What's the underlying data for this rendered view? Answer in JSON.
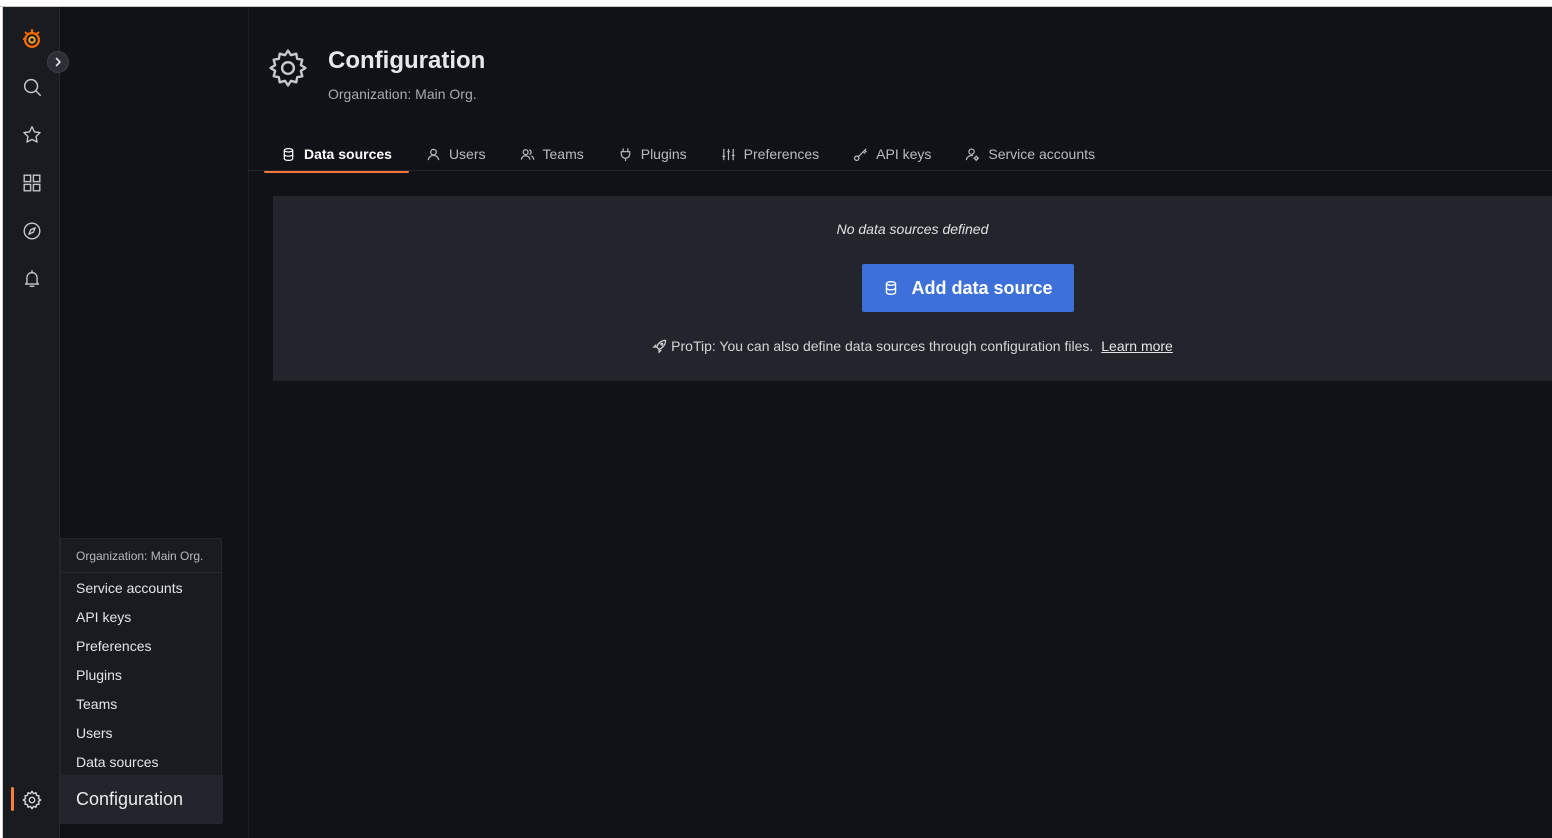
{
  "sidebar": {
    "icons": [
      "grafana-logo-icon",
      "search-icon",
      "star-icon",
      "dashboards-icon",
      "explore-compass-icon",
      "alerting-bell-icon",
      "configuration-gear-icon"
    ],
    "expand_icon": "chevron-right-icon",
    "accent_color": "#ff7d3a"
  },
  "flyout": {
    "header": "Organization: Main Org.",
    "items": [
      "Service accounts",
      "API keys",
      "Preferences",
      "Plugins",
      "Teams",
      "Users",
      "Data sources"
    ],
    "title": "Configuration"
  },
  "page": {
    "icon": "gear-icon",
    "title": "Configuration",
    "subtitle": "Organization: Main Org."
  },
  "tabs": [
    {
      "label": "Data sources",
      "icon": "database-icon",
      "active": true
    },
    {
      "label": "Users",
      "icon": "user-icon",
      "active": false
    },
    {
      "label": "Teams",
      "icon": "users-icon",
      "active": false
    },
    {
      "label": "Plugins",
      "icon": "plug-icon",
      "active": false
    },
    {
      "label": "Preferences",
      "icon": "sliders-icon",
      "active": false
    },
    {
      "label": "API keys",
      "icon": "key-icon",
      "active": false
    },
    {
      "label": "Service accounts",
      "icon": "user-cog-icon",
      "active": false
    }
  ],
  "empty_state": {
    "message": "No data sources defined",
    "button_label": "Add data source",
    "button_icon": "database-icon",
    "button_color": "#3d71d9",
    "protip_icon": "rocket-icon",
    "protip": "ProTip: You can also define data sources through configuration files.",
    "learn_more": "Learn more"
  },
  "colors": {
    "tab_active_underline": "#f3753b",
    "background": "#111217",
    "panel": "#22252b"
  }
}
